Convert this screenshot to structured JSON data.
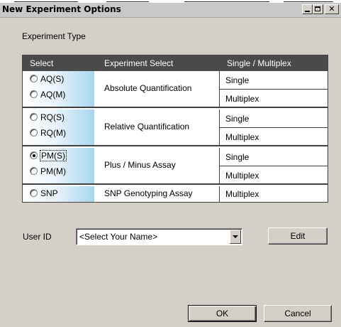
{
  "window": {
    "title": "New Experiment Options"
  },
  "experiment_type": {
    "label": "Experiment Type",
    "headers": {
      "select": "Select",
      "experiment": "Experiment Select",
      "multiplex": "Single / Multiplex"
    },
    "groups": [
      {
        "name": "Absolute Quantification",
        "options": [
          {
            "label": "AQ(S)",
            "selected": false,
            "mode": "Single"
          },
          {
            "label": "AQ(M)",
            "selected": false,
            "mode": "Multiplex"
          }
        ]
      },
      {
        "name": "Relative Quantification",
        "options": [
          {
            "label": "RQ(S)",
            "selected": false,
            "mode": "Single"
          },
          {
            "label": "RQ(M)",
            "selected": false,
            "mode": "Multiplex"
          }
        ]
      },
      {
        "name": "Plus / Minus Assay",
        "options": [
          {
            "label": "PM(S)",
            "selected": true,
            "mode": "Single"
          },
          {
            "label": "PM(M)",
            "selected": false,
            "mode": "Multiplex"
          }
        ]
      },
      {
        "name": "SNP Genotyping Assay",
        "options": [
          {
            "label": "SNP",
            "selected": false,
            "mode": "Multiplex"
          }
        ]
      }
    ]
  },
  "user": {
    "label": "User ID",
    "selected_value": "<Select Your Name>",
    "edit_label": "Edit"
  },
  "footer": {
    "ok_label": "OK",
    "cancel_label": "Cancel"
  }
}
